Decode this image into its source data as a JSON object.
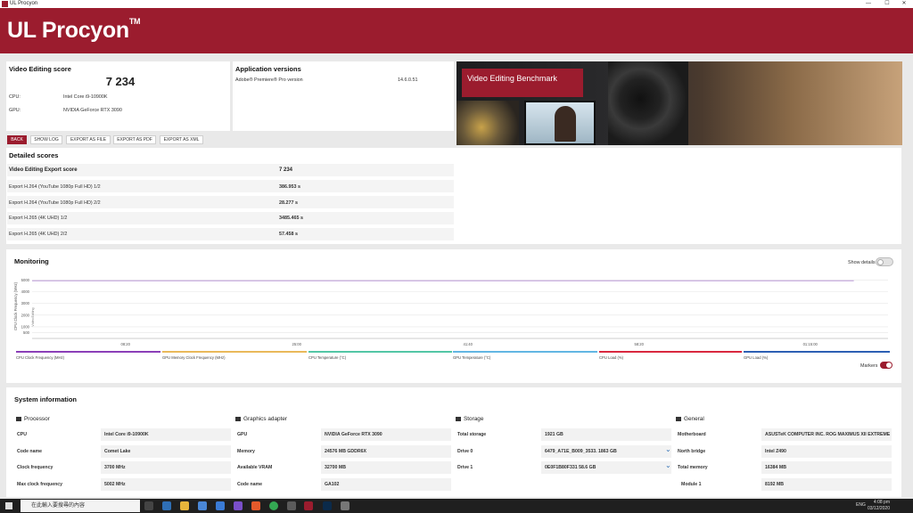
{
  "window": {
    "title": "UL Procyon",
    "controls": [
      "—",
      "☐",
      "✕"
    ]
  },
  "banner": {
    "logo": "UL Procyon",
    "tm": "TM"
  },
  "score": {
    "title": "Video Editing score",
    "value": "7 234",
    "cpu_label": "CPU:",
    "cpu_value": "Intel Core i9-10900K",
    "gpu_label": "GPU:",
    "gpu_value": "NVIDIA GeForce RTX 3090"
  },
  "app_versions": {
    "title": "Application versions",
    "app": "Adobe® Premiere® Pro version",
    "version": "14.6.0.51"
  },
  "buttons": {
    "back": "BACK",
    "show_log": "SHOW LOG",
    "export_file": "EXPORT AS FILE",
    "export_pdf": "EXPORT AS PDF",
    "export_xml": "EXPORT AS XML"
  },
  "hero": {
    "title": "Video Editing Benchmark"
  },
  "detailed": {
    "title": "Detailed scores",
    "rows": [
      {
        "label": "Video Editing Export score",
        "value": "7 234"
      },
      {
        "label": "Export H.264 (YouTube 1080p Full HD) 1/2",
        "value": "386.953 s"
      },
      {
        "label": "Export H.264 (YouTube 1080p Full HD) 2/2",
        "value": "28.277 s"
      },
      {
        "label": "Export H.265 (4K UHD) 1/2",
        "value": "3485.465 s"
      },
      {
        "label": "Export H.265 (4K UHD) 2/2",
        "value": "57.458 s"
      }
    ]
  },
  "monitoring": {
    "title": "Monitoring",
    "show_details": "Show details",
    "markers": "Markers",
    "ylabel": "CPU Clock Frequency (MHz)",
    "ylabel2": "Video Editing",
    "legend": [
      {
        "name": "CPU Clock Frequency (MHz)",
        "color": "#8b3fb8"
      },
      {
        "name": "GPU Memory Clock Frequency (MHz)",
        "color": "#e9b95a"
      },
      {
        "name": "CPU Temperature (°C)",
        "color": "#53c6a6"
      },
      {
        "name": "GPU Temperature (°C)",
        "color": "#62b6e3"
      },
      {
        "name": "CPU Load (%)",
        "color": "#d9283f"
      },
      {
        "name": "GPU Load (%)",
        "color": "#2c5fb3"
      }
    ]
  },
  "chart_data": {
    "type": "line",
    "ylabel": "CPU Clock Frequency (MHz)",
    "ylim": [
      0,
      5500
    ],
    "yticks": [
      "500",
      "1000",
      "2000",
      "3000",
      "4000",
      "5000"
    ],
    "xticks": [
      "08:20",
      "25:00",
      "41:40",
      "58:20",
      "01:15:00"
    ],
    "series": [
      {
        "name": "CPU Clock Frequency (MHz)",
        "x": [
          0,
          78
        ],
        "values": [
          4950,
          4950
        ]
      }
    ],
    "grid": true
  },
  "system": {
    "title": "System information",
    "sections": [
      {
        "name": "Processor",
        "icon": "cpu-icon",
        "rows": [
          {
            "k": "CPU",
            "v": "Intel Core i9-10900K"
          },
          {
            "k": "Code name",
            "v": "Comet Lake"
          },
          {
            "k": "Clock frequency",
            "v": "3700 MHz"
          },
          {
            "k": "Max clock frequency",
            "v": "5002 MHz"
          }
        ]
      },
      {
        "name": "Graphics adapter",
        "icon": "gpu-icon",
        "rows": [
          {
            "k": "GPU",
            "v": "NVIDIA GeForce RTX 3090"
          },
          {
            "k": "Memory",
            "v": "24576 MB GDDR6X"
          },
          {
            "k": "Available VRAM",
            "v": "32700 MB"
          },
          {
            "k": "Code name",
            "v": "GA102"
          }
        ]
      },
      {
        "name": "Storage",
        "icon": "storage-icon",
        "rows": [
          {
            "k": "Total storage",
            "v": "1921 GB"
          },
          {
            "k": "Drive 0",
            "v": "6479_A71E_B009_3533. 1863 GB"
          },
          {
            "k": "Drive 1",
            "v": "0E0F1B80F331 58.6 GB"
          }
        ]
      },
      {
        "name": "General",
        "icon": "general-icon",
        "rows": [
          {
            "k": "Motherboard",
            "v": "ASUSTeK COMPUTER INC. ROG MAXIMUS XII EXTREME"
          },
          {
            "k": "North bridge",
            "v": "Intel Z490"
          },
          {
            "k": "Total memory",
            "v": "16384 MB"
          },
          {
            "k": "Module 1",
            "v": "8192 MB"
          }
        ]
      }
    ]
  },
  "taskbar": {
    "search": "在此輸入要搜尋的內容",
    "time": "4:08 pm",
    "date": "03/12/2020",
    "lang": "ENG"
  }
}
